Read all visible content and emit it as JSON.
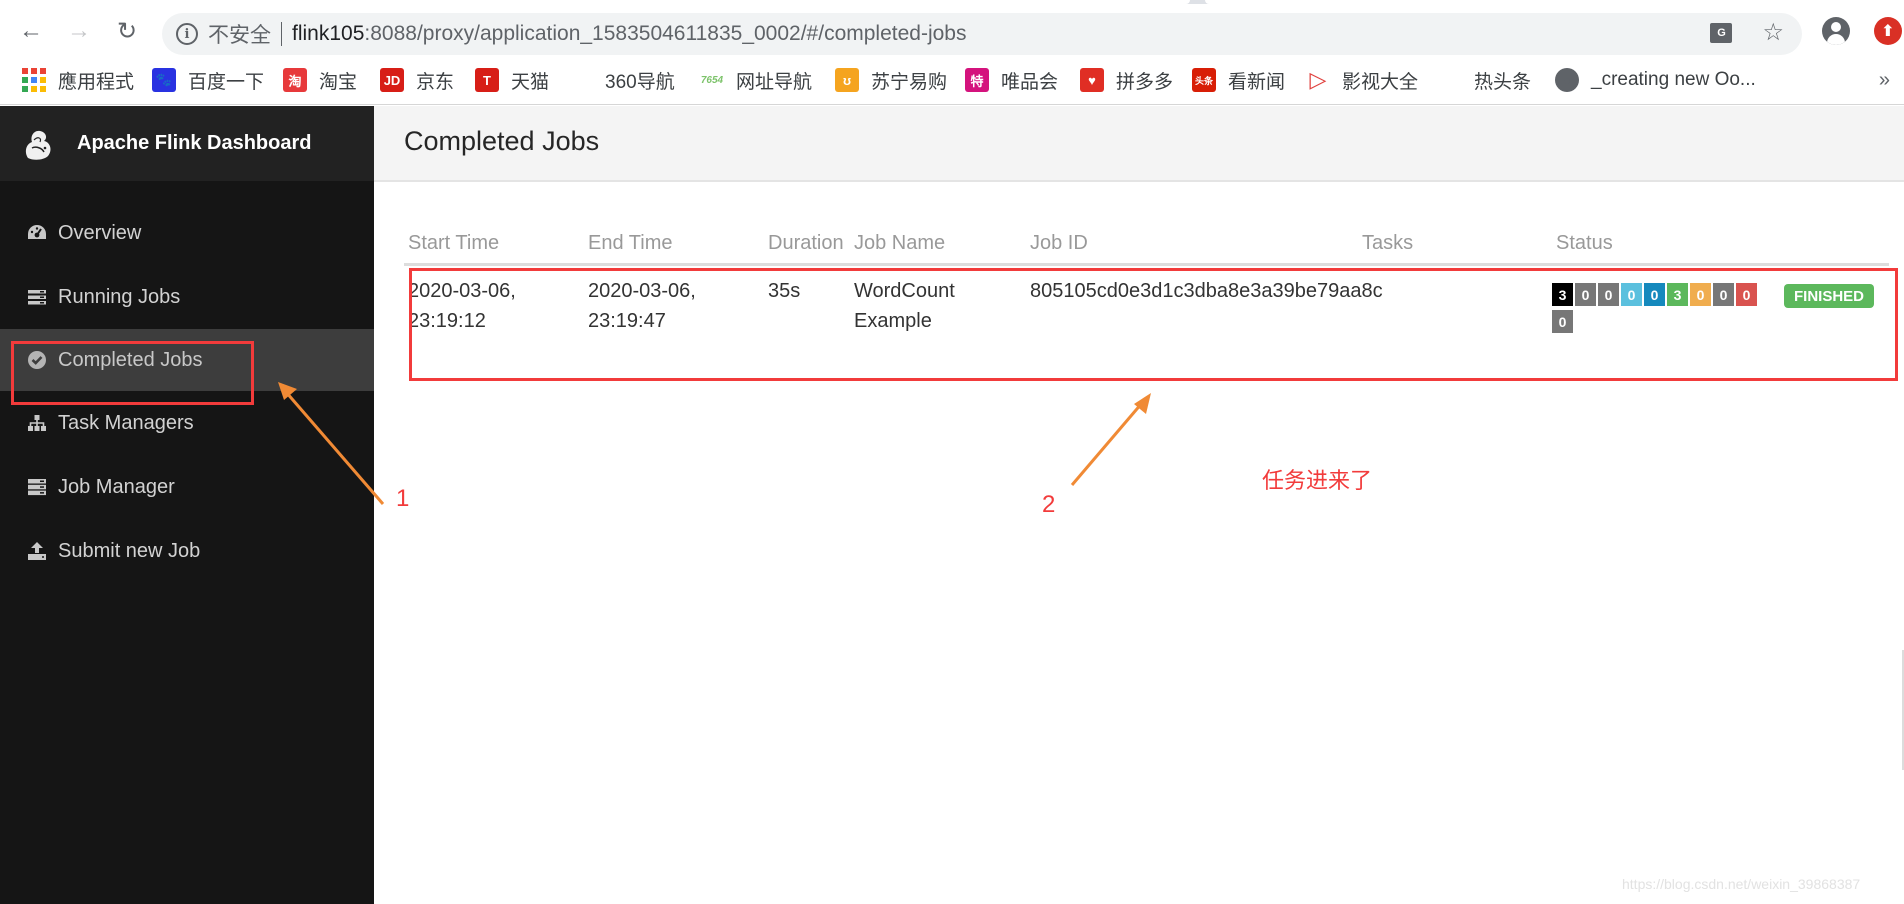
{
  "browser": {
    "security_label": "不安全",
    "url_host": "flink105",
    "url_rest": ":8088/proxy/application_1583504611835_0002/#/completed-jobs",
    "bookmarks": [
      {
        "label": "應用程式",
        "icon": "apps-grid-icon"
      },
      {
        "label": "百度一下",
        "icon": "baidu-paw-icon",
        "glyph": "🐾",
        "color": "#2932e1"
      },
      {
        "label": "淘宝",
        "icon": "taobao-icon",
        "glyph": "淘",
        "color": "#e7393b"
      },
      {
        "label": "京东",
        "icon": "jd-icon",
        "glyph": "JD",
        "color": "#d71e17"
      },
      {
        "label": "天猫",
        "icon": "tmall-icon",
        "glyph": "T",
        "color": "#d71e17"
      },
      {
        "label": "360导航",
        "icon": "none"
      },
      {
        "label": "网址导航",
        "icon": "7654-icon",
        "glyph": "7654",
        "color": "#7cc36a"
      },
      {
        "label": "苏宁易购",
        "icon": "suning-icon",
        "glyph": "ʊ",
        "color": "#f5a41f"
      },
      {
        "label": "唯品会",
        "icon": "vip-icon",
        "glyph": "特",
        "color": "#d4137d"
      },
      {
        "label": "拼多多",
        "icon": "pinduoduo-icon",
        "glyph": "♥",
        "color": "#e02e24"
      },
      {
        "label": "看新闻",
        "icon": "news-icon",
        "glyph": "头条",
        "color": "#d81e06"
      },
      {
        "label": "影视大全",
        "icon": "video-play-icon",
        "glyph": "▷",
        "color": "#e0413e"
      },
      {
        "label": "热头条",
        "icon": "none"
      },
      {
        "label": "_creating new Oo...",
        "icon": "globe-icon",
        "glyph": "●",
        "color": "#5f6368"
      }
    ],
    "more_label": "»"
  },
  "app": {
    "brand_title": "Apache Flink Dashboard",
    "nav": [
      {
        "label": "Overview",
        "icon": "dashboard-icon"
      },
      {
        "label": "Running Jobs",
        "icon": "tasks-list-icon"
      },
      {
        "label": "Completed Jobs",
        "icon": "check-circle-icon",
        "active": true
      },
      {
        "label": "Task Managers",
        "icon": "sitemap-icon"
      },
      {
        "label": "Job Manager",
        "icon": "server-icon"
      },
      {
        "label": "Submit new Job",
        "icon": "upload-icon"
      }
    ],
    "page_title": "Completed Jobs",
    "table": {
      "columns": [
        "Start Time",
        "End Time",
        "Duration",
        "Job Name",
        "Job ID",
        "Tasks",
        "Status"
      ],
      "rows": [
        {
          "start_time": [
            "2020-03-06,",
            "23:19:12"
          ],
          "end_time": [
            "2020-03-06,",
            "23:19:47"
          ],
          "duration": "35s",
          "job_name": [
            "WordCount",
            "Example"
          ],
          "job_id": "805105cd0e3d1c3dba8e3a39be79aa8c",
          "tasks": [
            {
              "value": "3",
              "state": "total",
              "color": "#000000"
            },
            {
              "value": "0",
              "state": "created",
              "color": "#777777"
            },
            {
              "value": "0",
              "state": "scheduled",
              "color": "#777777"
            },
            {
              "value": "0",
              "state": "deploying",
              "color": "#5bc0de"
            },
            {
              "value": "0",
              "state": "running",
              "color": "#1589bd"
            },
            {
              "value": "3",
              "state": "finished",
              "color": "#5cb85c"
            },
            {
              "value": "0",
              "state": "canceling",
              "color": "#f0ad4e"
            },
            {
              "value": "0",
              "state": "canceled",
              "color": "#777777"
            },
            {
              "value": "0",
              "state": "failed",
              "color": "#d9534f"
            },
            {
              "value": "0",
              "state": "reconciling",
              "color": "#777777"
            }
          ],
          "status": "FINISHED",
          "status_color": "#5cb85c"
        }
      ]
    }
  },
  "annotations": {
    "label_1": "1",
    "label_2": "2",
    "note": "任务进来了",
    "box_color": "#f23b3b",
    "arrow_color": "#f08a35"
  },
  "watermark": "https://blog.csdn.net/weixin_39868387"
}
